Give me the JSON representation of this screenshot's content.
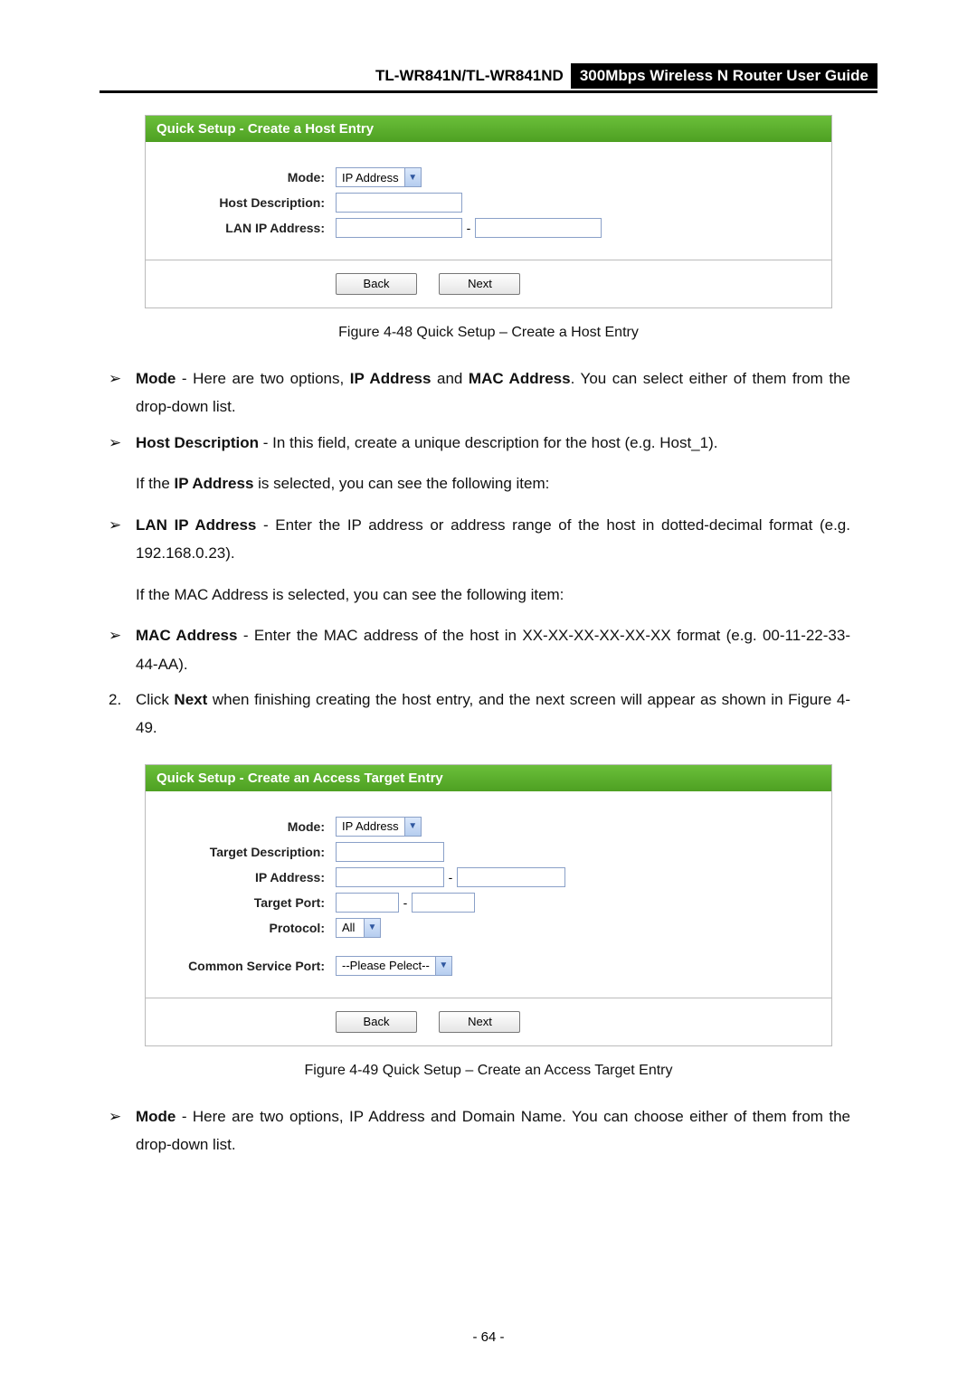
{
  "header": {
    "model": "TL-WR841N/TL-WR841ND",
    "guide": "300Mbps Wireless N Router User Guide"
  },
  "figure48": {
    "title": "Quick Setup - Create a Host Entry",
    "labels": {
      "mode": "Mode:",
      "hostDescription": "Host Description:",
      "lanIp": "LAN IP Address:"
    },
    "modeValue": "IP Address",
    "btnBack": "Back",
    "btnNext": "Next",
    "caption": "Figure 4-48    Quick Setup – Create a Host Entry"
  },
  "bullets": {
    "mode": {
      "lead": "Mode",
      "rest": " - Here are two options, ",
      "b1": "IP Address",
      "mid": " and ",
      "b2": "MAC Address",
      "tail": ". You can select either of them from the drop-down list."
    },
    "hostDesc": {
      "lead": "Host Description",
      "rest": " - In this field, create a unique description for the host (e.g. Host_1)."
    },
    "ipSelectedNote": {
      "pre": "If the ",
      "bold": "IP Address",
      "post": " is selected, you can see the following item:"
    },
    "lanIp": {
      "lead": "LAN IP Address",
      "rest": " - Enter the IP address or address range of the host in dotted-decimal format (e.g. 192.168.0.23)."
    },
    "macSelectedNote": "If the MAC Address is selected, you can see the following item:",
    "mac": {
      "lead": "MAC Address",
      "rest": " - Enter the MAC address of the host in XX-XX-XX-XX-XX-XX format (e.g. 00-11-22-33-44-AA)."
    },
    "step2": {
      "num": "2.",
      "pre": "Click ",
      "bold": "Next",
      "mid": " when finishing creating the host entry, and the next screen will appear as shown in ",
      "link": "Figure 4-49",
      "tail": "."
    },
    "modeTarget": {
      "lead": "Mode",
      "rest": " - Here are two options, IP Address and Domain Name. You can choose either of them from the drop-down list."
    }
  },
  "figure49": {
    "title": "Quick Setup - Create an Access Target Entry",
    "labels": {
      "mode": "Mode:",
      "targetDescription": "Target Description:",
      "ipAddress": "IP Address:",
      "targetPort": "Target Port:",
      "protocol": "Protocol:",
      "commonServicePort": "Common Service Port:"
    },
    "modeValue": "IP Address",
    "protocolValue": "All",
    "commonServiceValue": "--Please Pelect--",
    "btnBack": "Back",
    "btnNext": "Next",
    "caption": "Figure 4-49    Quick Setup – Create an Access Target Entry"
  },
  "footer": "- 64 -"
}
